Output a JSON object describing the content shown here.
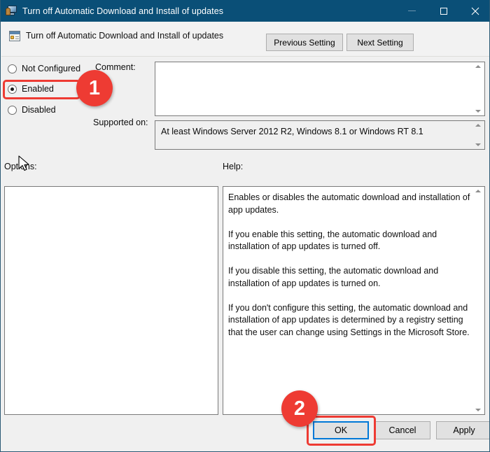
{
  "window": {
    "title": "Turn off Automatic Download and Install of updates",
    "title_icon": "policy-computer-icon",
    "controls": {
      "minimize": "minimize-icon",
      "maximize": "maximize-icon",
      "close": "close-icon"
    },
    "colors": {
      "titlebar": "#0a4f77",
      "dialog_background": "#f0f0f0",
      "button_face": "#e1e1e1",
      "focus_blue": "#0078d7",
      "annotation_red": "#ee3b33"
    }
  },
  "header": {
    "setting_name": "Turn off Automatic Download and Install of updates",
    "icon": "policy-setting-icon",
    "previous_label": "Previous Setting",
    "next_label": "Next Setting"
  },
  "state_options": [
    {
      "label": "Not Configured",
      "selected": false
    },
    {
      "label": "Enabled",
      "selected": true
    },
    {
      "label": "Disabled",
      "selected": false
    }
  ],
  "comment": {
    "label": "Comment:",
    "value": "",
    "placeholder": ""
  },
  "supported_on": {
    "label": "Supported on:",
    "value": "At least Windows Server 2012 R2, Windows 8.1 or Windows RT 8.1"
  },
  "options": {
    "label": "Options:",
    "content": ""
  },
  "help": {
    "label": "Help:",
    "text": "Enables or disables the automatic download and installation of app updates.\n\nIf you enable this setting, the automatic download and installation of app updates is turned off.\n\nIf you disable this setting, the automatic download and installation of app updates is turned on.\n\nIf you don't configure this setting, the automatic download and installation of app updates is determined by a registry setting that the user can change using Settings in the Microsoft Store."
  },
  "buttons": {
    "ok": "OK",
    "cancel": "Cancel",
    "apply": "Apply"
  },
  "annotations": [
    {
      "badge": "1",
      "target": "Enabled radio button"
    },
    {
      "badge": "2",
      "target": "OK button"
    }
  ]
}
